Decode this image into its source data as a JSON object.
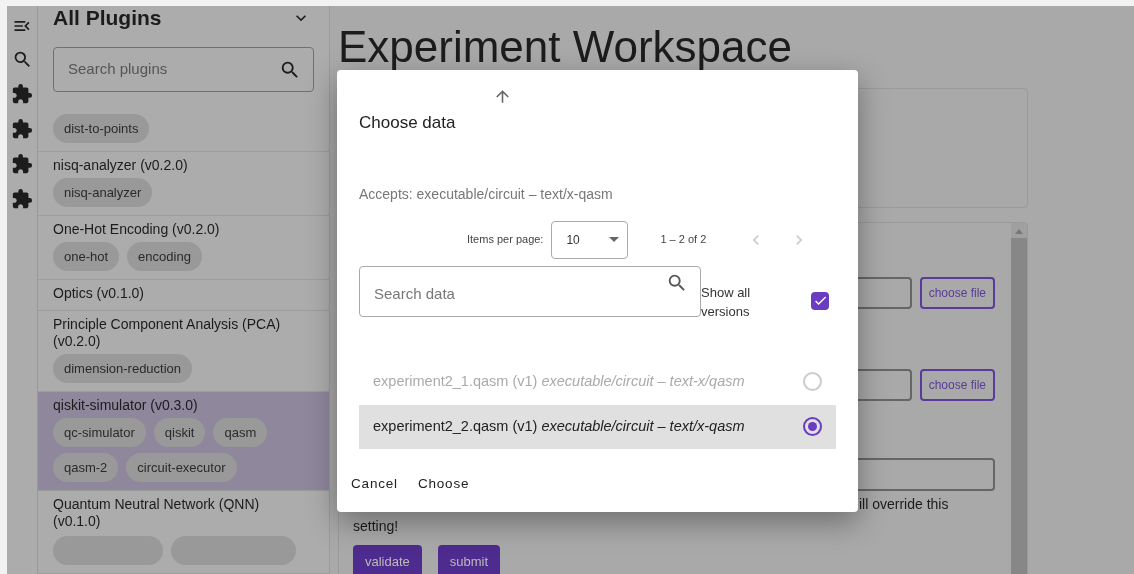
{
  "sidebar": {
    "title": "All Plugins",
    "search": {
      "placeholder": "Search plugins"
    },
    "plugins": [
      {
        "tags": [
          "dist-to-points"
        ],
        "selected": false
      },
      {
        "name": "nisq-analyzer (v0.2.0)",
        "tags": [
          "nisq-analyzer"
        ],
        "selected": false
      },
      {
        "name": "One-Hot Encoding (v0.2.0)",
        "tags": [
          "one-hot",
          "encoding"
        ],
        "selected": false
      },
      {
        "name": "Optics (v0.1.0)",
        "selected": false
      },
      {
        "name": "Principle Component Analysis (PCA) (v0.2.0)",
        "tags": [
          "dimension-reduction"
        ],
        "selected": false
      },
      {
        "name": "qiskit-simulator (v0.3.0)",
        "tags": [
          "qc-simulator",
          "qiskit",
          "qasm",
          "qasm-2",
          "circuit-executor"
        ],
        "selected": true
      },
      {
        "name": "Quantum Neutral Network (QNN) (v0.1.0)",
        "selected": false
      }
    ]
  },
  "main": {
    "title": "Experiment Workspace",
    "form": {
      "file_buttons": [
        "choose file",
        "choose file"
      ],
      "hint_parts": [
        "ill override this",
        "setting!"
      ],
      "buttons": [
        "validate",
        "submit"
      ]
    }
  },
  "dialog": {
    "title": "Choose data",
    "accepts": "Accepts: executable/circuit – text/x-qasm",
    "pagination": {
      "label": "Items per page:",
      "page_size": "10",
      "range": "1 – 2 of 2"
    },
    "search": {
      "placeholder": "Search data"
    },
    "show_all_versions": {
      "label": "Show all versions",
      "checked": true
    },
    "items": [
      {
        "name": "experiment2_1.qasm (v1)",
        "type": "executable/circuit – text-x/qasm",
        "selected": false,
        "disabled": true
      },
      {
        "name": "experiment2_2.qasm (v1)",
        "type": "executable/circuit – text/x-qasm",
        "selected": true,
        "disabled": false
      }
    ],
    "actions": [
      "Cancel",
      "Choose"
    ]
  }
}
